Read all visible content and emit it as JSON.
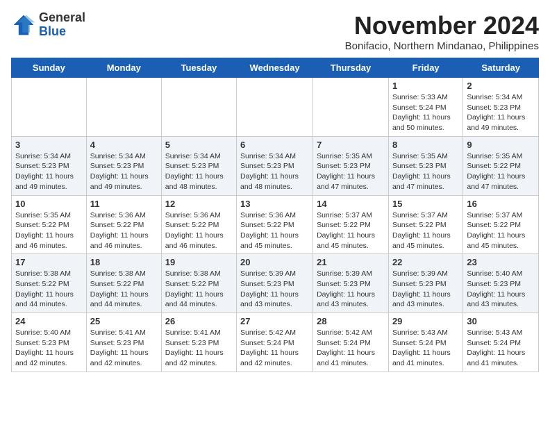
{
  "logo": {
    "general": "General",
    "blue": "Blue"
  },
  "header": {
    "month_year": "November 2024",
    "location": "Bonifacio, Northern Mindanao, Philippines"
  },
  "weekdays": [
    "Sunday",
    "Monday",
    "Tuesday",
    "Wednesday",
    "Thursday",
    "Friday",
    "Saturday"
  ],
  "weeks": [
    [
      {
        "day": "",
        "sunrise": "",
        "sunset": "",
        "daylight": ""
      },
      {
        "day": "",
        "sunrise": "",
        "sunset": "",
        "daylight": ""
      },
      {
        "day": "",
        "sunrise": "",
        "sunset": "",
        "daylight": ""
      },
      {
        "day": "",
        "sunrise": "",
        "sunset": "",
        "daylight": ""
      },
      {
        "day": "",
        "sunrise": "",
        "sunset": "",
        "daylight": ""
      },
      {
        "day": "1",
        "sunrise": "Sunrise: 5:33 AM",
        "sunset": "Sunset: 5:24 PM",
        "daylight": "Daylight: 11 hours and 50 minutes."
      },
      {
        "day": "2",
        "sunrise": "Sunrise: 5:34 AM",
        "sunset": "Sunset: 5:23 PM",
        "daylight": "Daylight: 11 hours and 49 minutes."
      }
    ],
    [
      {
        "day": "3",
        "sunrise": "Sunrise: 5:34 AM",
        "sunset": "Sunset: 5:23 PM",
        "daylight": "Daylight: 11 hours and 49 minutes."
      },
      {
        "day": "4",
        "sunrise": "Sunrise: 5:34 AM",
        "sunset": "Sunset: 5:23 PM",
        "daylight": "Daylight: 11 hours and 49 minutes."
      },
      {
        "day": "5",
        "sunrise": "Sunrise: 5:34 AM",
        "sunset": "Sunset: 5:23 PM",
        "daylight": "Daylight: 11 hours and 48 minutes."
      },
      {
        "day": "6",
        "sunrise": "Sunrise: 5:34 AM",
        "sunset": "Sunset: 5:23 PM",
        "daylight": "Daylight: 11 hours and 48 minutes."
      },
      {
        "day": "7",
        "sunrise": "Sunrise: 5:35 AM",
        "sunset": "Sunset: 5:23 PM",
        "daylight": "Daylight: 11 hours and 47 minutes."
      },
      {
        "day": "8",
        "sunrise": "Sunrise: 5:35 AM",
        "sunset": "Sunset: 5:23 PM",
        "daylight": "Daylight: 11 hours and 47 minutes."
      },
      {
        "day": "9",
        "sunrise": "Sunrise: 5:35 AM",
        "sunset": "Sunset: 5:22 PM",
        "daylight": "Daylight: 11 hours and 47 minutes."
      }
    ],
    [
      {
        "day": "10",
        "sunrise": "Sunrise: 5:35 AM",
        "sunset": "Sunset: 5:22 PM",
        "daylight": "Daylight: 11 hours and 46 minutes."
      },
      {
        "day": "11",
        "sunrise": "Sunrise: 5:36 AM",
        "sunset": "Sunset: 5:22 PM",
        "daylight": "Daylight: 11 hours and 46 minutes."
      },
      {
        "day": "12",
        "sunrise": "Sunrise: 5:36 AM",
        "sunset": "Sunset: 5:22 PM",
        "daylight": "Daylight: 11 hours and 46 minutes."
      },
      {
        "day": "13",
        "sunrise": "Sunrise: 5:36 AM",
        "sunset": "Sunset: 5:22 PM",
        "daylight": "Daylight: 11 hours and 45 minutes."
      },
      {
        "day": "14",
        "sunrise": "Sunrise: 5:37 AM",
        "sunset": "Sunset: 5:22 PM",
        "daylight": "Daylight: 11 hours and 45 minutes."
      },
      {
        "day": "15",
        "sunrise": "Sunrise: 5:37 AM",
        "sunset": "Sunset: 5:22 PM",
        "daylight": "Daylight: 11 hours and 45 minutes."
      },
      {
        "day": "16",
        "sunrise": "Sunrise: 5:37 AM",
        "sunset": "Sunset: 5:22 PM",
        "daylight": "Daylight: 11 hours and 45 minutes."
      }
    ],
    [
      {
        "day": "17",
        "sunrise": "Sunrise: 5:38 AM",
        "sunset": "Sunset: 5:22 PM",
        "daylight": "Daylight: 11 hours and 44 minutes."
      },
      {
        "day": "18",
        "sunrise": "Sunrise: 5:38 AM",
        "sunset": "Sunset: 5:22 PM",
        "daylight": "Daylight: 11 hours and 44 minutes."
      },
      {
        "day": "19",
        "sunrise": "Sunrise: 5:38 AM",
        "sunset": "Sunset: 5:22 PM",
        "daylight": "Daylight: 11 hours and 44 minutes."
      },
      {
        "day": "20",
        "sunrise": "Sunrise: 5:39 AM",
        "sunset": "Sunset: 5:23 PM",
        "daylight": "Daylight: 11 hours and 43 minutes."
      },
      {
        "day": "21",
        "sunrise": "Sunrise: 5:39 AM",
        "sunset": "Sunset: 5:23 PM",
        "daylight": "Daylight: 11 hours and 43 minutes."
      },
      {
        "day": "22",
        "sunrise": "Sunrise: 5:39 AM",
        "sunset": "Sunset: 5:23 PM",
        "daylight": "Daylight: 11 hours and 43 minutes."
      },
      {
        "day": "23",
        "sunrise": "Sunrise: 5:40 AM",
        "sunset": "Sunset: 5:23 PM",
        "daylight": "Daylight: 11 hours and 43 minutes."
      }
    ],
    [
      {
        "day": "24",
        "sunrise": "Sunrise: 5:40 AM",
        "sunset": "Sunset: 5:23 PM",
        "daylight": "Daylight: 11 hours and 42 minutes."
      },
      {
        "day": "25",
        "sunrise": "Sunrise: 5:41 AM",
        "sunset": "Sunset: 5:23 PM",
        "daylight": "Daylight: 11 hours and 42 minutes."
      },
      {
        "day": "26",
        "sunrise": "Sunrise: 5:41 AM",
        "sunset": "Sunset: 5:23 PM",
        "daylight": "Daylight: 11 hours and 42 minutes."
      },
      {
        "day": "27",
        "sunrise": "Sunrise: 5:42 AM",
        "sunset": "Sunset: 5:24 PM",
        "daylight": "Daylight: 11 hours and 42 minutes."
      },
      {
        "day": "28",
        "sunrise": "Sunrise: 5:42 AM",
        "sunset": "Sunset: 5:24 PM",
        "daylight": "Daylight: 11 hours and 41 minutes."
      },
      {
        "day": "29",
        "sunrise": "Sunrise: 5:43 AM",
        "sunset": "Sunset: 5:24 PM",
        "daylight": "Daylight: 11 hours and 41 minutes."
      },
      {
        "day": "30",
        "sunrise": "Sunrise: 5:43 AM",
        "sunset": "Sunset: 5:24 PM",
        "daylight": "Daylight: 11 hours and 41 minutes."
      }
    ]
  ]
}
